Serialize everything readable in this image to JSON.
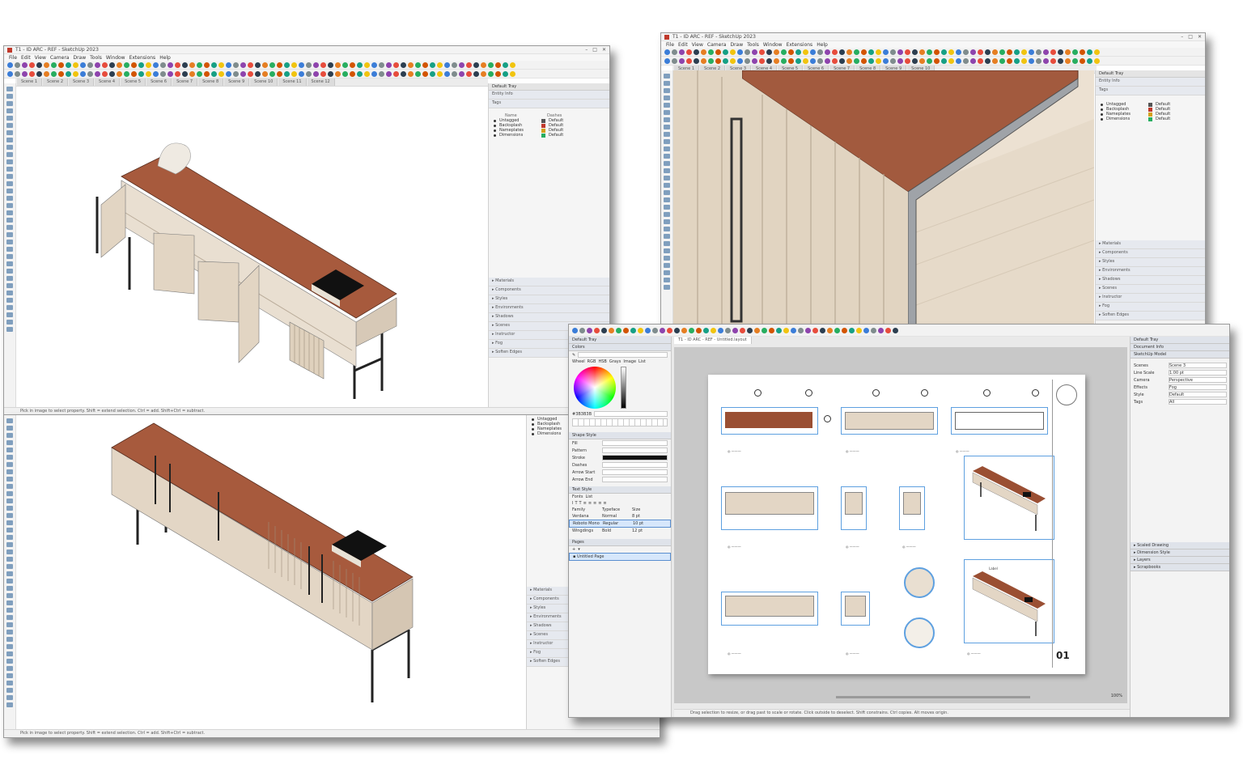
{
  "window1": {
    "title": "T1 - ID ARC - REF - SketchUp 2023",
    "menus": [
      "File",
      "Edit",
      "View",
      "Camera",
      "Draw",
      "Tools",
      "Window",
      "Extensions",
      "Help"
    ],
    "scene_tabs": [
      "Scene 1",
      "Scene 2",
      "Scene 3",
      "Scene 4",
      "Scene 5",
      "Scene 6",
      "Scene 7",
      "Scene 8",
      "Scene 9",
      "Scene 10",
      "Scene 11",
      "Scene 12"
    ],
    "tray_title": "Default Tray",
    "tray_sections_top": [
      "Entity Info",
      "Tags"
    ],
    "tags_header": [
      "Name",
      "Dashes"
    ],
    "tags": [
      {
        "name": "Untagged",
        "dash": "Default",
        "color": "#555555"
      },
      {
        "name": "Backsplash",
        "dash": "Default",
        "color": "#c0392b"
      },
      {
        "name": "Nameplates",
        "dash": "Default",
        "color": "#d4a017"
      },
      {
        "name": "Dimensions",
        "dash": "Default",
        "color": "#27ae60"
      }
    ],
    "tray_sections_bottom": [
      "Materials",
      "Components",
      "Styles",
      "Environments",
      "Shadows",
      "Scenes",
      "Instructor",
      "Fog",
      "Soften Edges"
    ],
    "status": "Pick in image to select property. Shift = extend selection. Ctrl = add. Shift+Ctrl = subtract."
  },
  "window2": {
    "title": "T1 - ID ARC - REF - SketchUp 2023",
    "menus": [
      "File",
      "Edit",
      "View",
      "Camera",
      "Draw",
      "Tools",
      "Window",
      "Extensions",
      "Help"
    ],
    "scene_tabs": [
      "Scene 1",
      "Scene 2",
      "Scene 3",
      "Scene 4",
      "Scene 5",
      "Scene 6",
      "Scene 7",
      "Scene 8",
      "Scene 9",
      "Scene 10"
    ],
    "tray_title": "Default Tray",
    "tray_sections_top": [
      "Entity Info",
      "Tags"
    ],
    "tags": [
      {
        "name": "Untagged",
        "dash": "Default",
        "color": "#555555"
      },
      {
        "name": "Backsplash",
        "dash": "Default",
        "color": "#c0392b"
      },
      {
        "name": "Nameplates",
        "dash": "Default",
        "color": "#d4a017"
      },
      {
        "name": "Dimensions",
        "dash": "Default",
        "color": "#27ae60"
      }
    ],
    "tray_sections_bottom": [
      "Materials",
      "Components",
      "Styles",
      "Environments",
      "Shadows",
      "Scenes",
      "Instructor",
      "Fog",
      "Soften Edges"
    ]
  },
  "window3": {
    "tags": [
      "Untagged",
      "Backsplash",
      "Nameplates",
      "Dimensions"
    ],
    "tray_sections_bottom": [
      "Materials",
      "Components",
      "Styles",
      "Environments",
      "Shadows",
      "Scenes",
      "Instructor",
      "Fog",
      "Soften Edges"
    ],
    "status": "Pick in image to select property. Shift = extend selection. Ctrl = add. Shift+Ctrl = subtract."
  },
  "layout": {
    "doc_tab": "T1 - ID ARC - REF - Untitled.layout",
    "left_tray_title": "Default Tray",
    "colors_title": "Colors",
    "color_modes": [
      "Wheel",
      "RGB",
      "HSB",
      "Grays",
      "Image",
      "List"
    ],
    "hex_value": "#3B3B3B",
    "shape_style_title": "Shape Style",
    "shape_rows": [
      "Fill",
      "Pattern",
      "Stroke",
      "Dashes",
      "Arrow Start",
      "Arrow End"
    ],
    "text_style_title": "Text Style",
    "text_style_tabs": [
      "Fonts",
      "List"
    ],
    "font_headers": [
      "Family",
      "Typeface",
      "Size"
    ],
    "font_rows": [
      [
        "Verdana",
        "Normal",
        "8 pt"
      ],
      [
        "Roboto Mono",
        "Regular",
        "10 pt"
      ],
      [
        "Wingdings",
        "Bold",
        "12 pt"
      ]
    ],
    "pages_title": "Pages",
    "pages": [
      "Untitled Page"
    ],
    "right_tray_title": "Default Tray",
    "right_sections": [
      "Document Info",
      "SketchUp Model"
    ],
    "model_fields": [
      [
        "Scenes",
        "Scene 3"
      ],
      [
        "Line Scale",
        "1.00 pt"
      ],
      [
        "Camera",
        "Perspective"
      ],
      [
        "Effects",
        "Fog"
      ],
      [
        "Style",
        "Default"
      ],
      [
        "Tags",
        "All"
      ]
    ],
    "right_bottom_sections": [
      "Scaled Drawing",
      "Dimension Style",
      "Layers",
      "Scrapbooks"
    ],
    "status": "Drag selection to resize, or drag past to scale or rotate. Click outside to deselect. Shift constrains. Ctrl copies. Alt moves origin.",
    "zoom": "100%",
    "sheet_number": "01",
    "label_text": "Label"
  }
}
